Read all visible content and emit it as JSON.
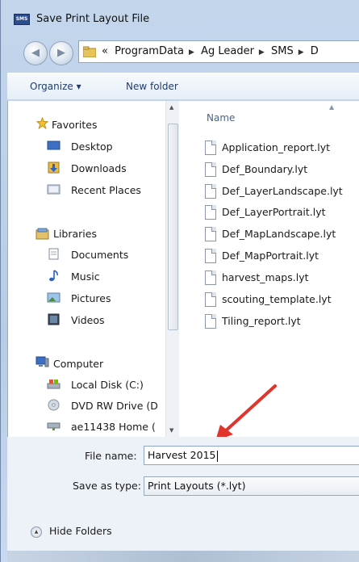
{
  "window": {
    "title": "Save Print Layout File",
    "app_icon_text": "SMS"
  },
  "address_bar": {
    "overflow": "«",
    "crumbs": [
      "ProgramData",
      "Ag Leader",
      "SMS",
      "D"
    ]
  },
  "toolbar": {
    "organize_label": "Organize ▾",
    "new_folder_label": "New folder"
  },
  "nav_pane": {
    "favorites": {
      "label": "Favorites",
      "items": [
        "Desktop",
        "Downloads",
        "Recent Places"
      ]
    },
    "libraries": {
      "label": "Libraries",
      "items": [
        "Documents",
        "Music",
        "Pictures",
        "Videos"
      ]
    },
    "computer": {
      "label": "Computer",
      "items": [
        "Local Disk (C:)",
        "DVD RW Drive (D",
        "ae11438 Home ("
      ]
    }
  },
  "file_list": {
    "column_header": "Name",
    "files": [
      "Application_report.lyt",
      "Def_Boundary.lyt",
      "Def_LayerLandscape.lyt",
      "Def_LayerPortrait.lyt",
      "Def_MapLandscape.lyt",
      "Def_MapPortrait.lyt",
      "harvest_maps.lyt",
      "scouting_template.lyt",
      "Tiling_report.lyt"
    ]
  },
  "form": {
    "file_name_label": "File name:",
    "file_name_value": "Harvest 2015",
    "save_as_type_label": "Save as type:",
    "save_as_type_value": "Print Layouts (*.lyt)"
  },
  "footer": {
    "hide_folders_label": "Hide Folders"
  },
  "colors": {
    "annotation_arrow": "#e0342c"
  }
}
